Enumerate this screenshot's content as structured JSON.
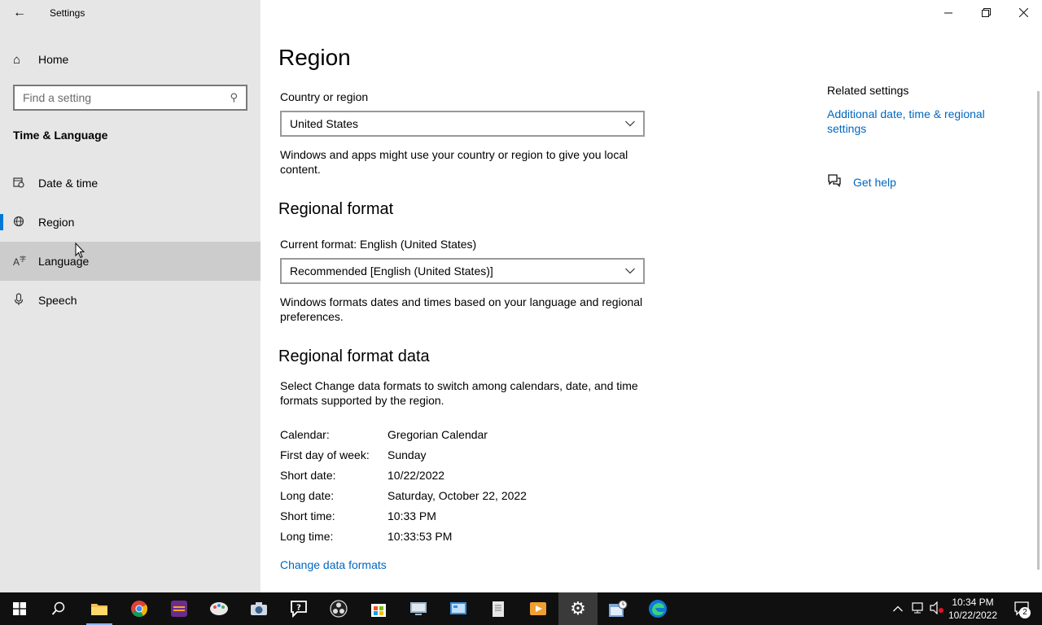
{
  "window": {
    "title": "Settings",
    "controls": {
      "minimize": "—",
      "restore": "❐",
      "close": "✕"
    }
  },
  "sidebar": {
    "home_label": "Home",
    "search_placeholder": "Find a setting",
    "section_title": "Time & Language",
    "items": [
      {
        "label": "Date & time",
        "icon": "calendar-clock-icon",
        "glyph": "📅"
      },
      {
        "label": "Region",
        "icon": "globe-icon",
        "glyph": "🌐"
      },
      {
        "label": "Language",
        "icon": "language-icon",
        "glyph": "A字"
      },
      {
        "label": "Speech",
        "icon": "microphone-icon",
        "glyph": "🎙"
      }
    ],
    "selected_item": "Region"
  },
  "main": {
    "page_title": "Region",
    "country_label": "Country or region",
    "country_value": "United States",
    "country_desc": "Windows and apps might use your country or region to give you local content.",
    "regional_format_heading": "Regional format",
    "current_format_label": "Current format: English (United States)",
    "format_value": "Recommended [English (United States)]",
    "format_desc": "Windows formats dates and times based on your language and regional preferences.",
    "format_data_heading": "Regional format data",
    "format_data_desc": "Select Change data formats to switch among calendars, date, and time formats supported by the region.",
    "format_data": [
      {
        "key": "Calendar:",
        "value": "Gregorian Calendar"
      },
      {
        "key": "First day of week:",
        "value": "Sunday"
      },
      {
        "key": "Short date:",
        "value": "10/22/2022"
      },
      {
        "key": "Long date:",
        "value": "Saturday, October 22, 2022"
      },
      {
        "key": "Short time:",
        "value": "10:33 PM"
      },
      {
        "key": "Long time:",
        "value": "10:33:53 PM"
      }
    ],
    "change_link": "Change data formats"
  },
  "related": {
    "title": "Related settings",
    "link": "Additional date, time & regional settings",
    "help_label": "Get help"
  },
  "taskbar": {
    "apps": [
      "start",
      "search",
      "file-explorer",
      "chrome",
      "app-retro",
      "paint-app",
      "camera",
      "tips",
      "obs",
      "store",
      "remote-desktop",
      "control-panel",
      "notepad-app",
      "media-app",
      "settings",
      "scheduler",
      "edge"
    ],
    "clock_time": "10:34 PM",
    "clock_date": "10/22/2022",
    "notification_count": "2"
  },
  "colors": {
    "accent": "#0078d7",
    "link": "#0067c0",
    "sidebar_bg": "#e6e6e6",
    "taskbar_bg": "#101010"
  }
}
